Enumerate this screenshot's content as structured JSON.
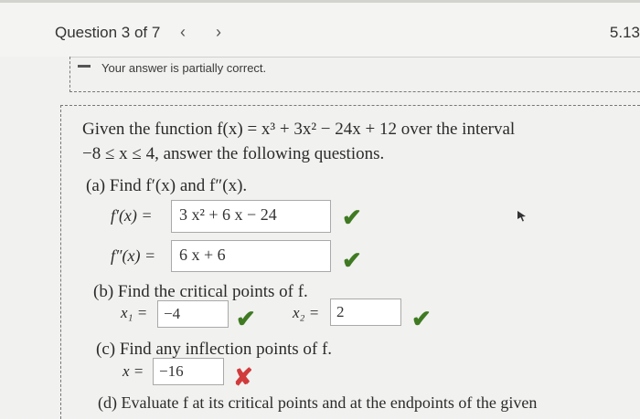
{
  "header": {
    "question_label": "Question 3 of 7",
    "prev_glyph": "‹",
    "next_glyph": "›",
    "score": "5.13"
  },
  "status": {
    "icon": "minus-icon",
    "message": "Your answer is partially correct."
  },
  "question": {
    "intro_line1": "Given the function f(x) = x³ + 3x² − 24x + 12 over the interval",
    "intro_line2": "−8 ≤ x ≤ 4, answer the following questions.",
    "part_a": {
      "label": "(a) Find f′(x) and f″(x).",
      "fprime_label": "f′(x) =",
      "fprime_value": "3 x² + 6 x − 24",
      "fdouble_label": "f″(x) =",
      "fdouble_value": "6 x + 6"
    },
    "part_b": {
      "label": "(b) Find the critical points of f.",
      "x1_label": "x₁ =",
      "x1_value": "−4",
      "x2_label": "x₂ =",
      "x2_value": "2"
    },
    "part_c": {
      "label": "(c) Find any inflection points of f.",
      "x_label": "x =",
      "x_value": "−16"
    },
    "part_d": {
      "label": "(d) Evaluate f at its critical points and at the endpoints of the given"
    }
  },
  "marks": {
    "correct_glyph": "✔",
    "incorrect_glyph": "✘"
  },
  "colors": {
    "correct": "#3f7a22",
    "incorrect": "#d13b3b"
  }
}
